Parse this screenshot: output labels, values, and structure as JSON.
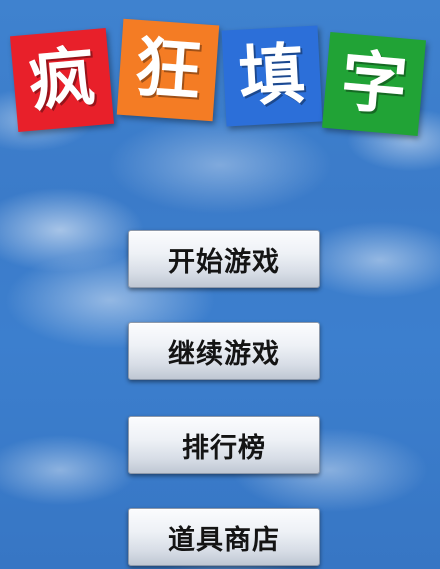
{
  "title": {
    "chars": [
      {
        "text": "疯",
        "color": "#e8202a"
      },
      {
        "text": "狂",
        "color": "#f47c24"
      },
      {
        "text": "填",
        "color": "#2c6fd9"
      },
      {
        "text": "字",
        "color": "#21a336"
      }
    ]
  },
  "menu": {
    "start_label": "开始游戏",
    "continue_label": "继续游戏",
    "ranking_label": "排行榜",
    "shop_label": "道具商店"
  },
  "colors": {
    "background_sky": "#3c7fce",
    "button_face": "#e6eaf0",
    "button_text": "#141414"
  }
}
